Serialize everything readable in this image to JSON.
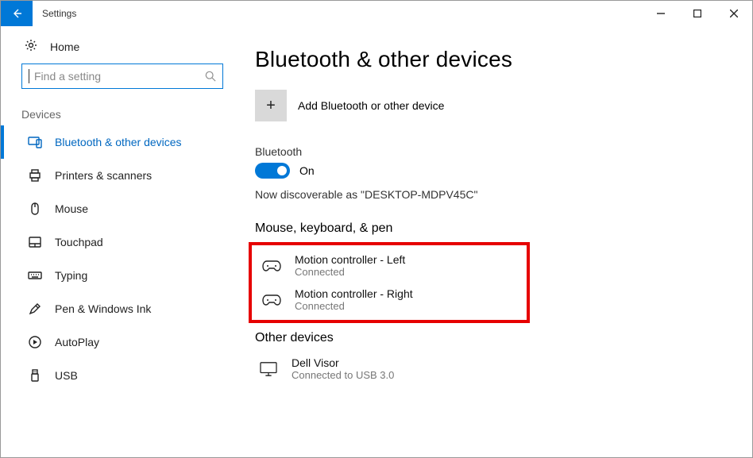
{
  "window": {
    "title": "Settings"
  },
  "sidebar": {
    "home": "Home",
    "search_placeholder": "Find a setting",
    "section": "Devices",
    "items": [
      {
        "label": "Bluetooth & other devices"
      },
      {
        "label": "Printers & scanners"
      },
      {
        "label": "Mouse"
      },
      {
        "label": "Touchpad"
      },
      {
        "label": "Typing"
      },
      {
        "label": "Pen & Windows Ink"
      },
      {
        "label": "AutoPlay"
      },
      {
        "label": "USB"
      }
    ]
  },
  "main": {
    "title": "Bluetooth & other devices",
    "add_label": "Add Bluetooth or other device",
    "bt_label": "Bluetooth",
    "bt_state": "On",
    "discover_text": "Now discoverable as \"DESKTOP-MDPV45C\"",
    "group1_title": "Mouse, keyboard, & pen",
    "devices1": [
      {
        "name": "Motion controller - Left",
        "status": "Connected"
      },
      {
        "name": "Motion controller - Right",
        "status": "Connected"
      }
    ],
    "group2_title": "Other devices",
    "devices2": [
      {
        "name": "Dell Visor",
        "status": "Connected to USB 3.0"
      }
    ]
  }
}
